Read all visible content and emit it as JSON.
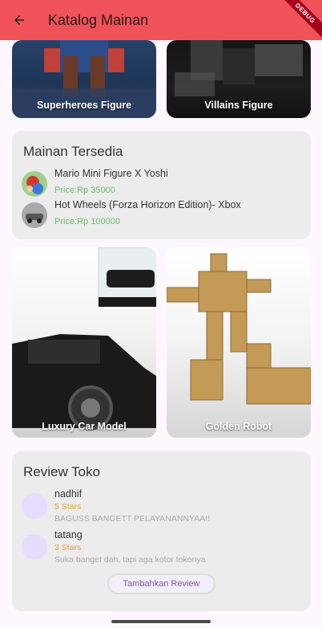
{
  "appbar": {
    "title": "Katalog Mainan",
    "back_icon": "arrow-left-icon",
    "debug": "DEBUG",
    "color": "#f0525a"
  },
  "categories_top": [
    {
      "label": "Superheroes Figure"
    },
    {
      "label": "Villains Figure"
    }
  ],
  "available": {
    "title": "Mainan Tersedia",
    "items": [
      {
        "name": "Mario Mini Figure X Yoshi",
        "price": "Price:Rp 35000"
      },
      {
        "name": "Hot Wheels (Forza Horizon Edition)- Xbox",
        "price": "Price:Rp 100000"
      }
    ]
  },
  "categories_mid": [
    {
      "label": "Luxury Car Model"
    },
    {
      "label": "Golden Robot"
    }
  ],
  "reviews": {
    "title": "Review Toko",
    "items": [
      {
        "name": "nadhif",
        "stars": "5 Stars",
        "text": "BAGUSS BANGETT PELAYANANNYAA!!"
      },
      {
        "name": "tatang",
        "stars": "3 Stars",
        "text": "Suka banget dah, tapi aga kotor tokonya"
      }
    ],
    "add_button": "Tambahkan Review"
  }
}
